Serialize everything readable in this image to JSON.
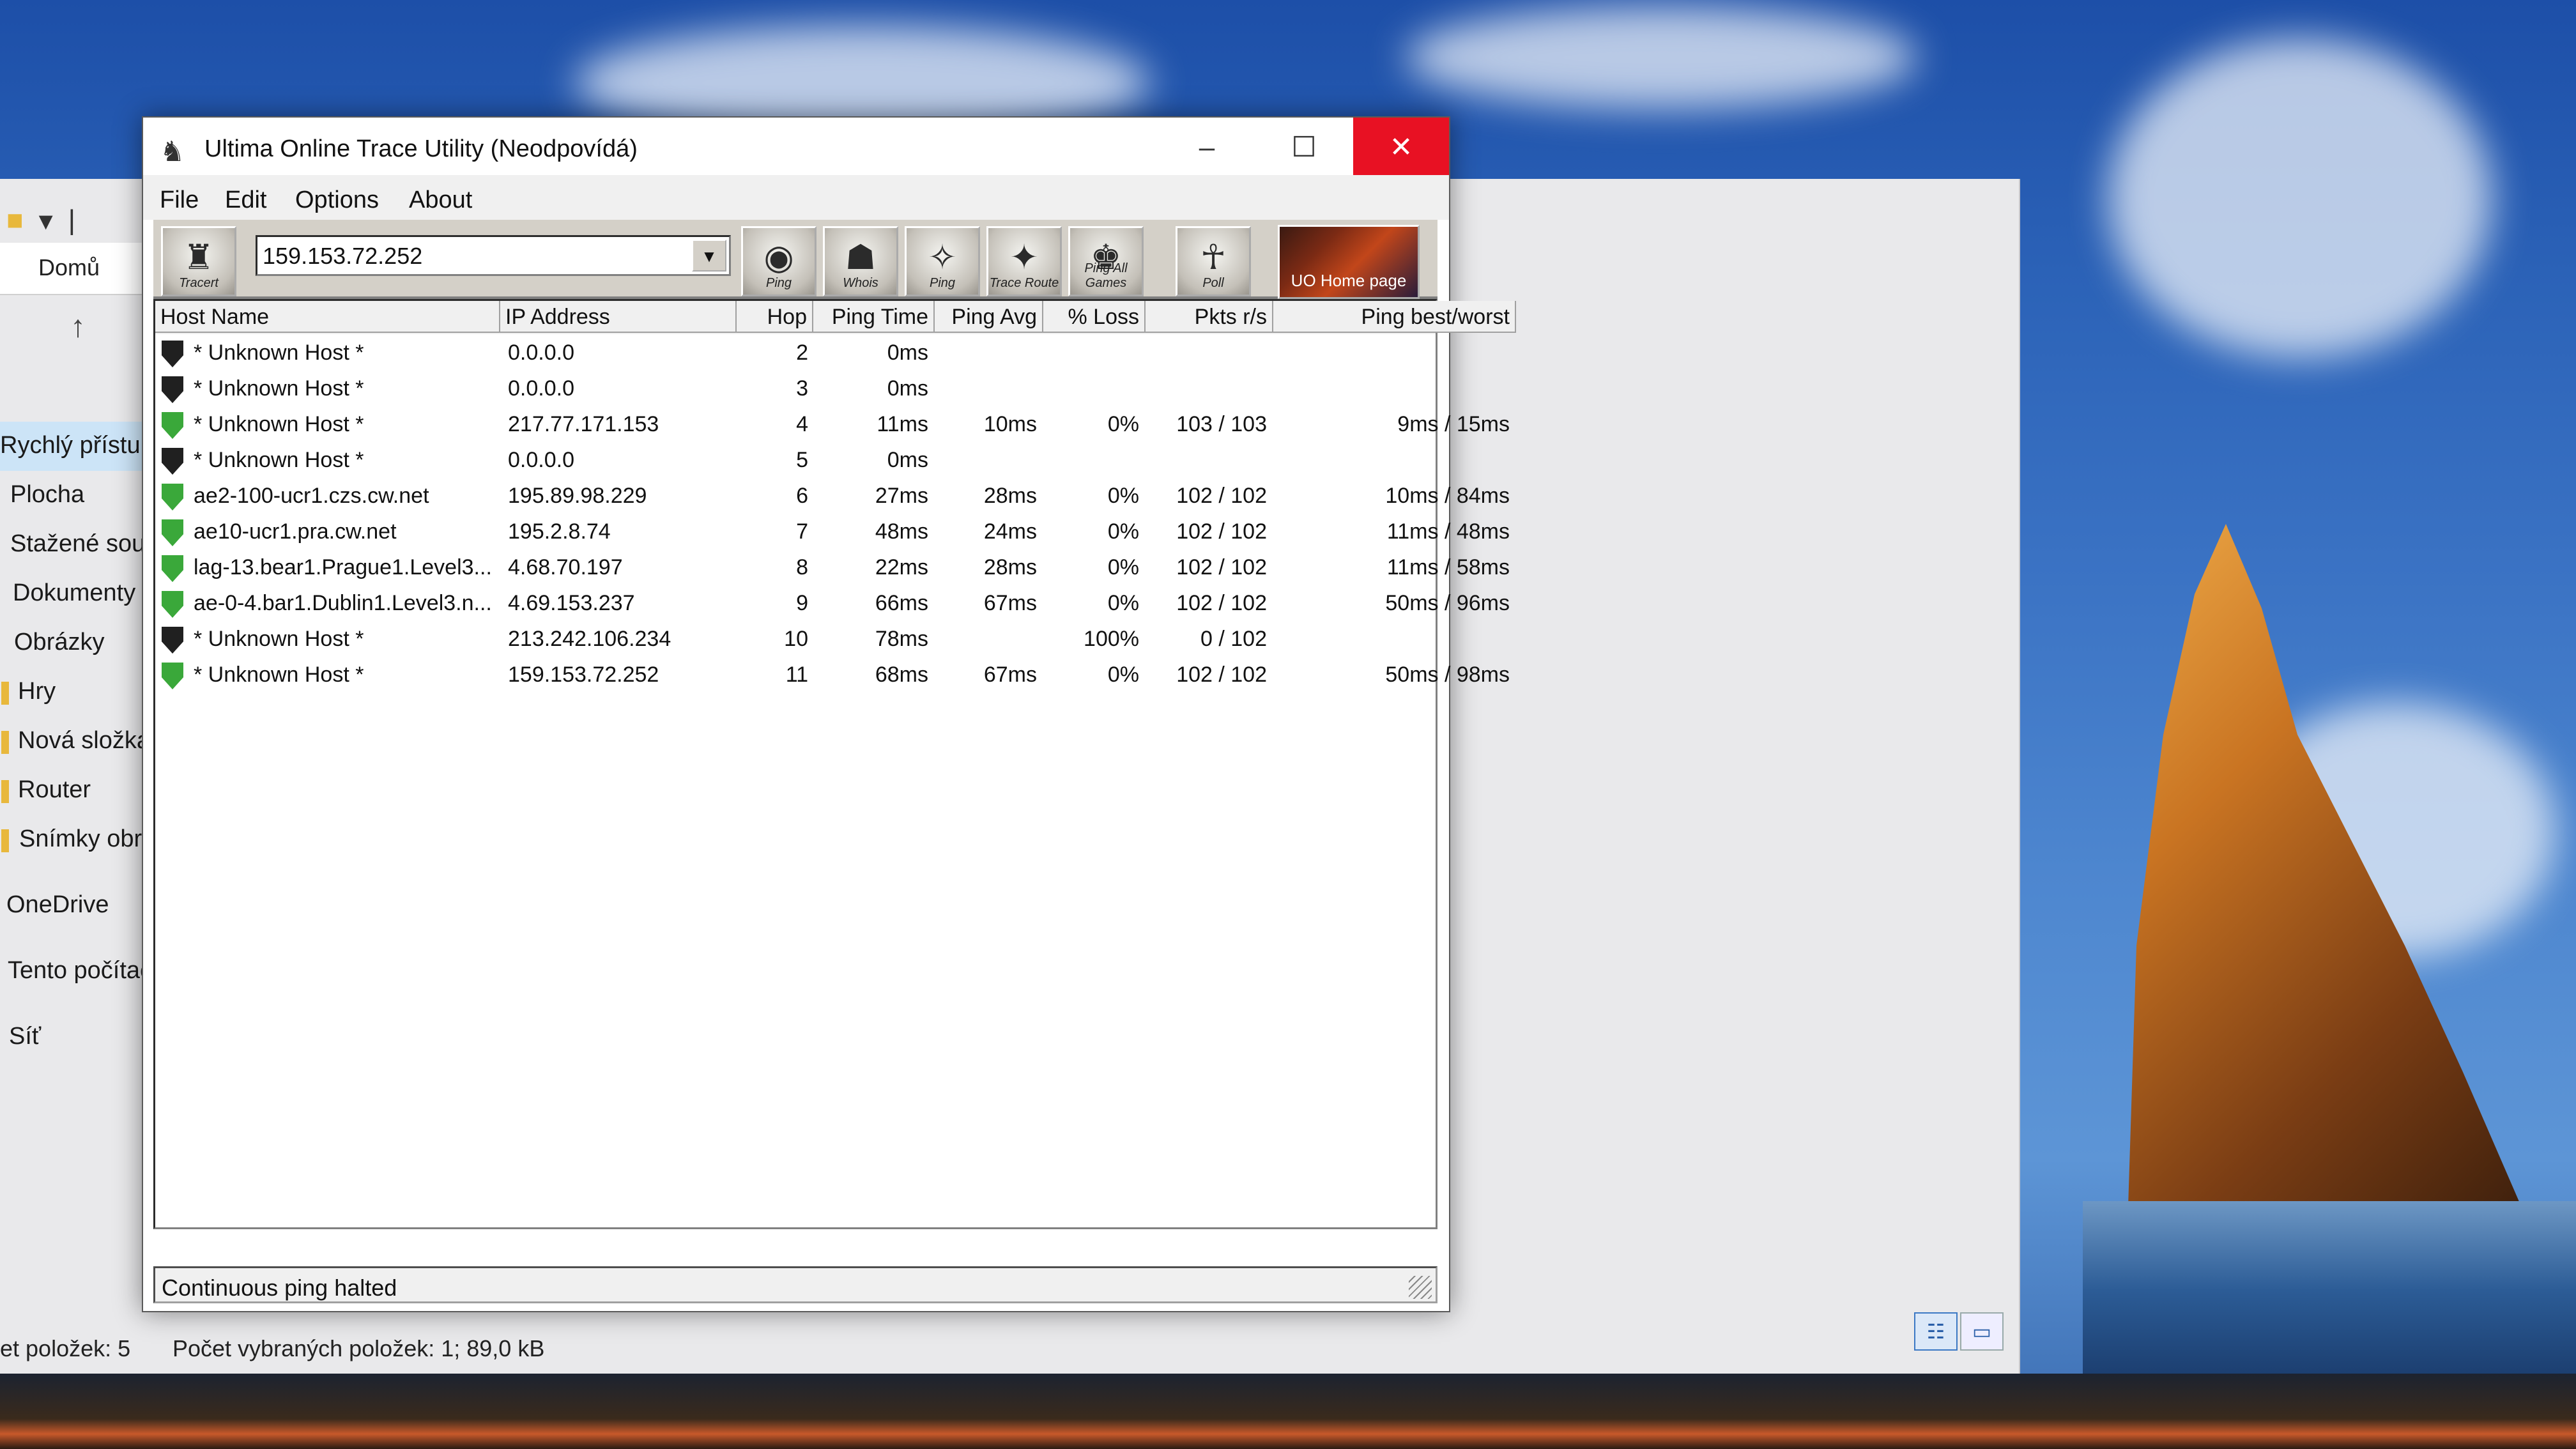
{
  "colors": {
    "close_red": "#e81123",
    "shield_ok": "#3aa83a",
    "shield_unknown": "#202020"
  },
  "explorer": {
    "tab_label": "Domů",
    "sidebar": [
      {
        "label": "Rychlý přístup",
        "selected": true
      },
      {
        "label": "Plocha"
      },
      {
        "label": "Stažené soub"
      },
      {
        "label": "Dokumenty"
      },
      {
        "label": "Obrázky"
      },
      {
        "label": "Hry"
      },
      {
        "label": "Nová složka ("
      },
      {
        "label": "Router"
      },
      {
        "label": "Snímky obraz"
      },
      {
        "label": "OneDrive"
      },
      {
        "label": "Tento počítač"
      },
      {
        "label": "Síť"
      }
    ],
    "status_items": "et položek: 5",
    "status_selected": "Počet vybraných položek: 1; 89,0 kB"
  },
  "app": {
    "title": "Ultima Online Trace Utility (Neodpovídá)",
    "window_controls": {
      "minimize": "–",
      "maximize": "☐",
      "close": "✕"
    },
    "menu": [
      "File",
      "Edit",
      "Options",
      "About"
    ],
    "toolbar": {
      "first_button": "Tracert",
      "address_value": "159.153.72.252",
      "buttons": [
        "Ping",
        "Whois",
        "Ping",
        "Trace Route",
        "Ping All Games",
        "Poll"
      ],
      "home_button": "UO Home page"
    },
    "columns": [
      "Host Name",
      "IP Address",
      "Hop",
      "Ping Time",
      "Ping Avg",
      "% Loss",
      "Pkts r/s",
      "Ping best/worst"
    ],
    "rows": [
      {
        "status": "unknown",
        "host": "* Unknown Host *",
        "ip": "0.0.0.0",
        "hop": "2",
        "ping": "0ms",
        "avg": "",
        "loss": "",
        "pkts": "",
        "bw": ""
      },
      {
        "status": "unknown",
        "host": "* Unknown Host *",
        "ip": "0.0.0.0",
        "hop": "3",
        "ping": "0ms",
        "avg": "",
        "loss": "",
        "pkts": "",
        "bw": ""
      },
      {
        "status": "ok",
        "host": "* Unknown Host *",
        "ip": "217.77.171.153",
        "hop": "4",
        "ping": "11ms",
        "avg": "10ms",
        "loss": "0%",
        "pkts": "103 / 103",
        "bw": "9ms / 15ms"
      },
      {
        "status": "unknown",
        "host": "* Unknown Host *",
        "ip": "0.0.0.0",
        "hop": "5",
        "ping": "0ms",
        "avg": "",
        "loss": "",
        "pkts": "",
        "bw": ""
      },
      {
        "status": "ok",
        "host": "ae2-100-ucr1.czs.cw.net",
        "ip": "195.89.98.229",
        "hop": "6",
        "ping": "27ms",
        "avg": "28ms",
        "loss": "0%",
        "pkts": "102 / 102",
        "bw": "10ms / 84ms"
      },
      {
        "status": "ok",
        "host": "ae10-ucr1.pra.cw.net",
        "ip": "195.2.8.74",
        "hop": "7",
        "ping": "48ms",
        "avg": "24ms",
        "loss": "0%",
        "pkts": "102 / 102",
        "bw": "11ms / 48ms"
      },
      {
        "status": "ok",
        "host": "lag-13.bear1.Prague1.Level3...",
        "ip": "4.68.70.197",
        "hop": "8",
        "ping": "22ms",
        "avg": "28ms",
        "loss": "0%",
        "pkts": "102 / 102",
        "bw": "11ms / 58ms"
      },
      {
        "status": "ok",
        "host": "ae-0-4.bar1.Dublin1.Level3.n...",
        "ip": "4.69.153.237",
        "hop": "9",
        "ping": "66ms",
        "avg": "67ms",
        "loss": "0%",
        "pkts": "102 / 102",
        "bw": "50ms / 96ms"
      },
      {
        "status": "unknown",
        "host": "* Unknown Host *",
        "ip": "213.242.106.234",
        "hop": "10",
        "ping": "78ms",
        "avg": "",
        "loss": "100%",
        "pkts": "0 / 102",
        "bw": ""
      },
      {
        "status": "ok",
        "host": "* Unknown Host *",
        "ip": "159.153.72.252",
        "hop": "11",
        "ping": "68ms",
        "avg": "67ms",
        "loss": "0%",
        "pkts": "102 / 102",
        "bw": "50ms / 98ms"
      }
    ],
    "status": "Continuous ping halted"
  }
}
